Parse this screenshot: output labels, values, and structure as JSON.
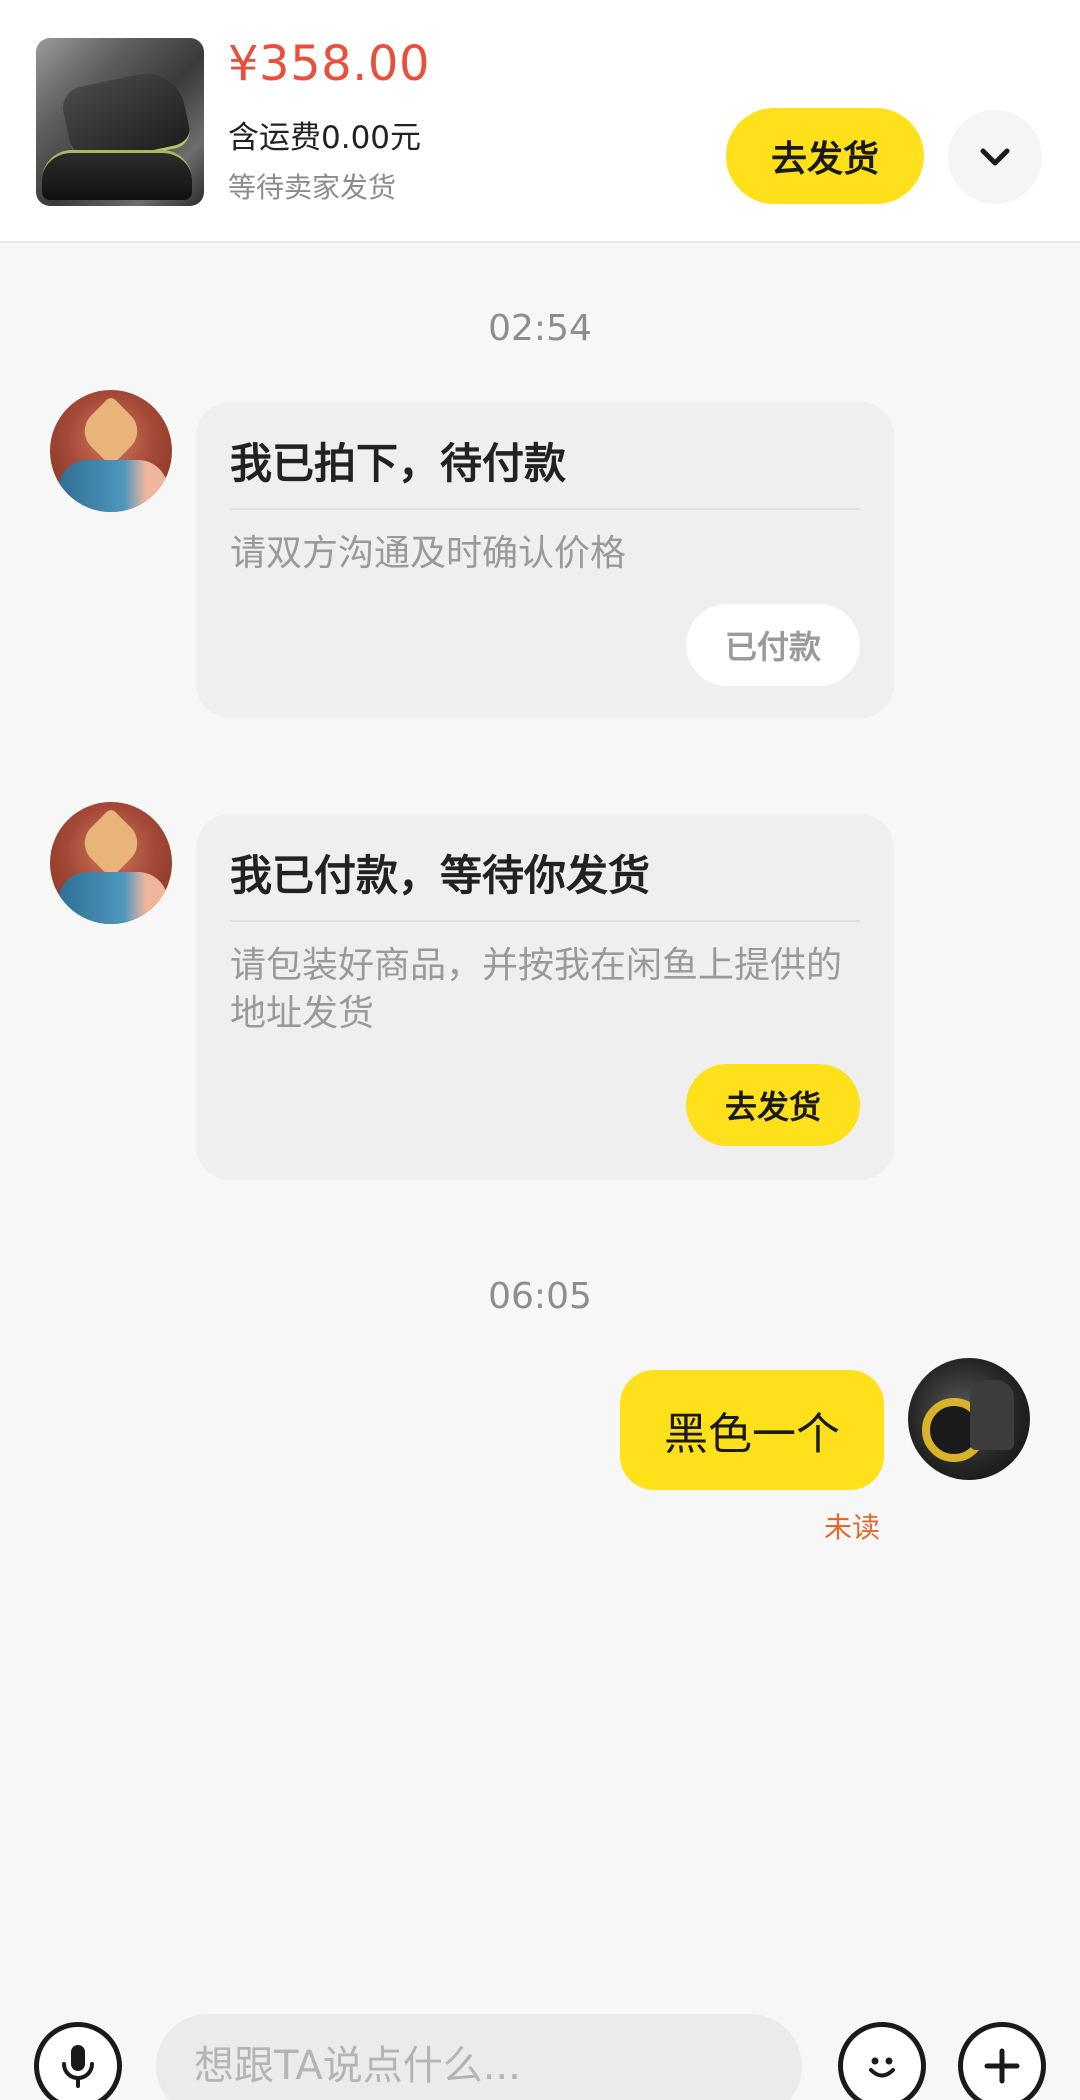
{
  "product": {
    "price": "¥358.00",
    "shipping_fee": "含运费0.00元",
    "status": "等待卖家发货",
    "ship_button": "去发货",
    "thumbnail_icon": "car-seat-cushion-photo"
  },
  "chat": {
    "timestamps": [
      "02:54",
      "06:05"
    ],
    "system_cards": [
      {
        "title": "我已拍下，待付款",
        "description": "请双方沟通及时确认价格",
        "button_label": "已付款"
      },
      {
        "title": "我已付款，等待你发货",
        "description": "请包装好商品，并按我在闲鱼上提供的地址发货",
        "button_label": "去发货"
      }
    ],
    "my_message": {
      "text": "黑色一个",
      "read_status": "未读"
    }
  },
  "input_bar": {
    "placeholder": "想跟TA说点什么..."
  },
  "colors": {
    "accent_yellow": "#ffe11b",
    "price_red": "#e8503d",
    "unread_orange": "#e0692e",
    "card_gray": "#efeff0"
  }
}
